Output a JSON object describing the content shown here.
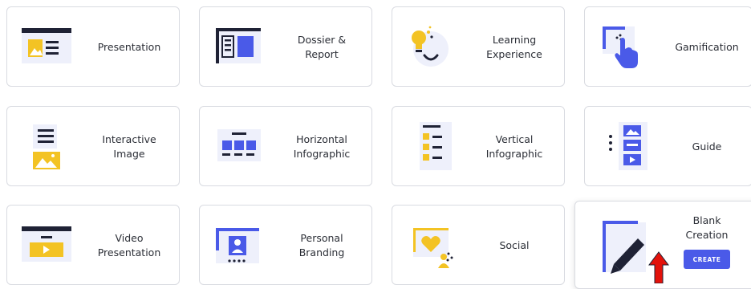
{
  "cards": [
    {
      "label": "Presentation",
      "icon": "presentation-icon"
    },
    {
      "label": "Dossier & Report",
      "icon": "dossier-report-icon"
    },
    {
      "label": "Learning\nExperience",
      "icon": "lightbulb-icon"
    },
    {
      "label": "Gamification",
      "icon": "hand-pointer-icon"
    },
    {
      "label": "Interactive\nImage",
      "icon": "interactive-image-icon"
    },
    {
      "label": "Horizontal\nInfographic",
      "icon": "horizontal-infographic-icon"
    },
    {
      "label": "Vertical\nInfographic",
      "icon": "vertical-infographic-icon"
    },
    {
      "label": "Guide",
      "icon": "guide-icon"
    },
    {
      "label": "Video\nPresentation",
      "icon": "video-icon"
    },
    {
      "label": "Personal\nBranding",
      "icon": "personal-branding-icon"
    },
    {
      "label": "Social",
      "icon": "social-heart-icon"
    },
    {
      "label": "Blank Creation",
      "icon": "pen-icon"
    }
  ],
  "blank_creation": {
    "button_label": "CREATE"
  },
  "colors": {
    "accent": "#4a5ae8",
    "yellow": "#f3c324",
    "dark": "#1f2235",
    "border": "#d9dbe1",
    "arrow": "#e3120b"
  }
}
